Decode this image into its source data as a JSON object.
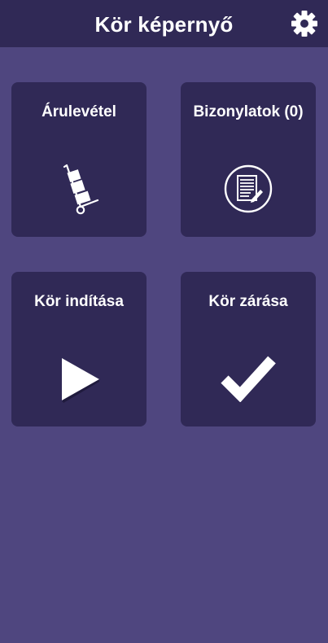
{
  "header": {
    "title": "Kör képernyő",
    "settings_icon": "gear-icon"
  },
  "tiles": [
    {
      "label": "Árulevétel",
      "icon": "hand-truck-icon"
    },
    {
      "label": "Bizonylatok (0)",
      "icon": "document-edit-icon"
    },
    {
      "label": "Kör indítása",
      "icon": "play-icon"
    },
    {
      "label": "Kör zárása",
      "icon": "checkmark-icon"
    }
  ],
  "colors": {
    "background": "#4f467f",
    "header": "#302956",
    "tile": "#302956",
    "text": "#ffffff"
  }
}
